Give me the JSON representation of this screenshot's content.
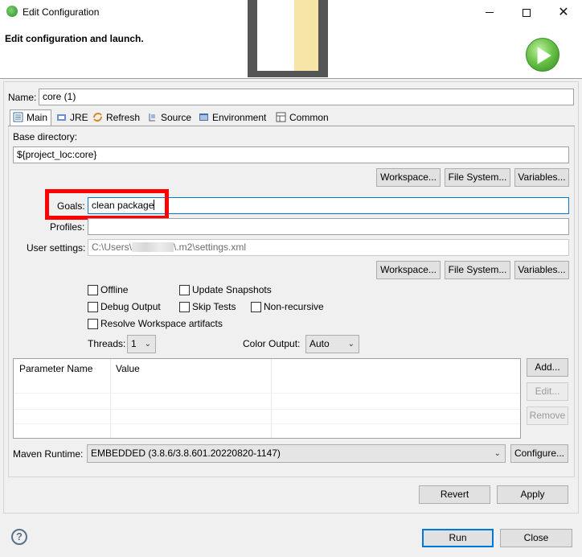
{
  "window": {
    "title": "Edit Configuration",
    "minimize": "—",
    "maximize": "□",
    "close": "✕"
  },
  "banner": {
    "title": "Edit configuration and launch."
  },
  "name": {
    "label": "Name:",
    "value": "core (1)"
  },
  "tabs": [
    {
      "label": "Main",
      "icon": "main-tab-icon"
    },
    {
      "label": "JRE",
      "icon": "jre-icon"
    },
    {
      "label": "Refresh",
      "icon": "refresh-icon"
    },
    {
      "label": "Source",
      "icon": "source-icon"
    },
    {
      "label": "Environment",
      "icon": "environment-icon"
    },
    {
      "label": "Common",
      "icon": "common-icon"
    }
  ],
  "base_directory": {
    "label": "Base directory:",
    "value": "${project_loc:core}",
    "buttons": [
      "Workspace...",
      "File System...",
      "Variables..."
    ]
  },
  "goals": {
    "label": "Goals:",
    "value": "clean package"
  },
  "profiles": {
    "label": "Profiles:",
    "value": ""
  },
  "user_settings": {
    "label": "User settings:",
    "value_prefix": "C:\\Users\\",
    "value_suffix": "\\.m2\\settings.xml",
    "buttons": [
      "Workspace...",
      "File System...",
      "Variables..."
    ]
  },
  "options": {
    "offline": "Offline",
    "update_snapshots": "Update Snapshots",
    "debug_output": "Debug Output",
    "skip_tests": "Skip Tests",
    "non_recursive": "Non-recursive",
    "resolve_workspace": "Resolve Workspace artifacts"
  },
  "threads": {
    "label": "Threads:",
    "value": "1"
  },
  "color_output": {
    "label": "Color Output:",
    "value": "Auto"
  },
  "parameters": {
    "columns": [
      "Parameter Name",
      "Value"
    ],
    "rows": [],
    "add": "Add...",
    "edit": "Edit...",
    "remove": "Remove"
  },
  "maven_runtime": {
    "label": "Maven Runtime:",
    "value": "EMBEDDED (3.8.6/3.8.601.20220820-1147)",
    "configure": "Configure..."
  },
  "footer": {
    "revert": "Revert",
    "apply": "Apply",
    "run": "Run",
    "close": "Close",
    "help": "?"
  }
}
